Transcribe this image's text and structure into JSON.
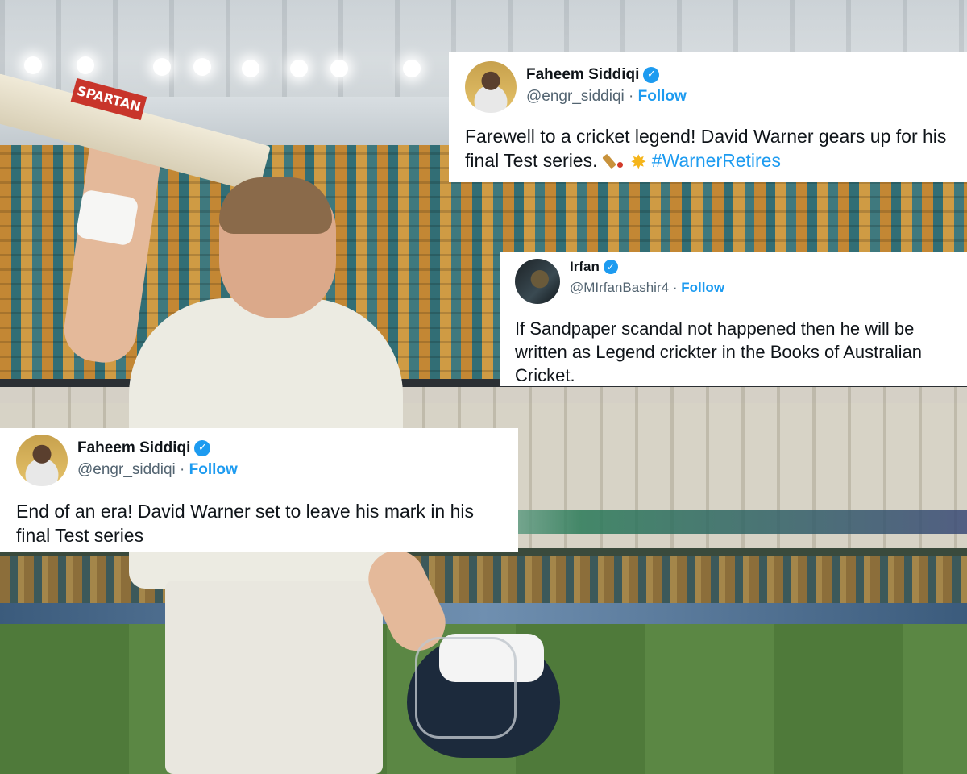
{
  "tweets": [
    {
      "name": "Faheem Siddiqi",
      "handle": "@engr_siddiqi",
      "separator": "·",
      "follow": "Follow",
      "text": "Farewell to a cricket legend! David Warner gears up for his final Test series.",
      "hashtag": "#WarnerRetires",
      "emojis": [
        "cricket-bat-emoji",
        "star-emoji"
      ]
    },
    {
      "name": "Irfan",
      "handle": "@MIrfanBashir4",
      "separator": "·",
      "follow": "Follow",
      "text": "If Sandpaper scandal not happened then he will be written as Legend crickter in the Books of Australian Cricket."
    },
    {
      "name": "Faheem Siddiqi",
      "handle": "@engr_siddiqi",
      "separator": "·",
      "follow": "Follow",
      "text": "End of an era! David Warner set to leave his mark in his final Test series"
    }
  ],
  "verified_badge": "✓",
  "bat_brand": "SPARTAN",
  "colors": {
    "link_blue": "#1d9bf0",
    "handle_gray": "#536471",
    "text_dark": "#0f1419"
  }
}
